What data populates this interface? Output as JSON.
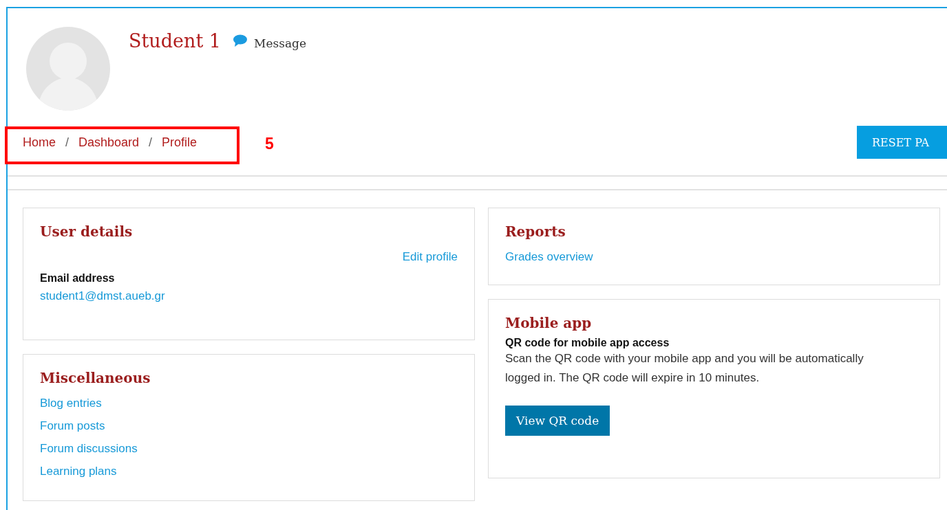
{
  "profile": {
    "name": "Student 1",
    "message_link": "Message"
  },
  "breadcrumb": {
    "separator": "/",
    "items": [
      "Home",
      "Dashboard",
      "Profile"
    ]
  },
  "annotation": {
    "label": "5"
  },
  "reset_button": "RESET PA",
  "user_details": {
    "title": "User details",
    "edit_link": "Edit profile",
    "email_label": "Email address",
    "email": "student1@dmst.aueb.gr"
  },
  "miscellaneous": {
    "title": "Miscellaneous",
    "links": [
      "Blog entries",
      "Forum posts",
      "Forum discussions",
      "Learning plans"
    ]
  },
  "reports": {
    "title": "Reports",
    "links": [
      "Grades overview"
    ]
  },
  "mobile_app": {
    "title": "Mobile app",
    "subtitle": "QR code for mobile app access",
    "text": "Scan the QR code with your mobile app and you will be automatically logged in. The QR code will expire in 10 minutes.",
    "button": "View QR code"
  }
}
